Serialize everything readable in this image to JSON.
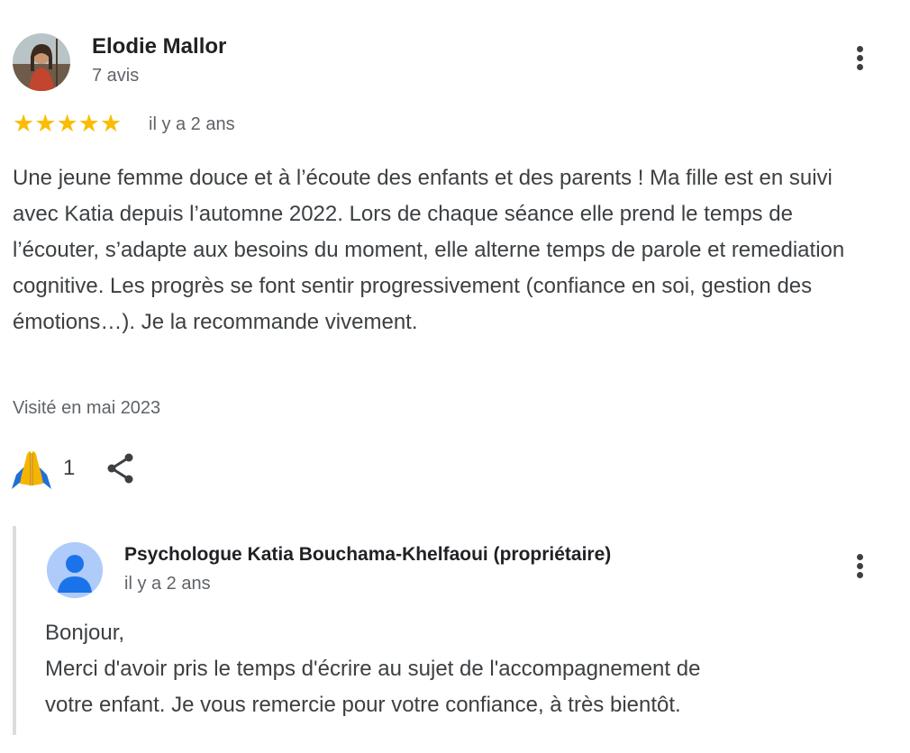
{
  "review": {
    "reviewer_name": "Elodie Mallor",
    "reviewer_meta": "7 avis",
    "rating": 5,
    "rating_max": 5,
    "date": "il y a 2 ans",
    "text": "Une jeune femme douce et à l’écoute des enfants et des parents ! Ma fille est en suivi avec Katia depuis l’automne 2022. Lors de chaque séance elle prend le temps de l’écouter, s’adapte aux besoins du moment, elle alterne temps de parole et remediation cognitive. Les progrès se font sentir progressivement (confiance en soi, gestion des émotions…). Je la recommande vivement.",
    "visited": "Visité en mai 2023",
    "reaction_count": "1",
    "icons": {
      "reaction": "praying-hands-icon",
      "share": "share-icon",
      "menu": "more-vertical-icon"
    }
  },
  "reply": {
    "owner_name": "Psychologue Katia Bouchama-Khelfaoui (propriétaire)",
    "date": "il y a 2 ans",
    "lines": [
      "Bonjour,",
      "Merci d'avoir pris le temps d'écrire au sujet de l'accompagnement de",
      "votre enfant. Je vous remercie pour votre confiance, à très bientôt."
    ]
  },
  "colors": {
    "star": "#fbbc04",
    "owner_avatar_bg": "#aecbfa",
    "owner_avatar_fg": "#1a73e8"
  }
}
